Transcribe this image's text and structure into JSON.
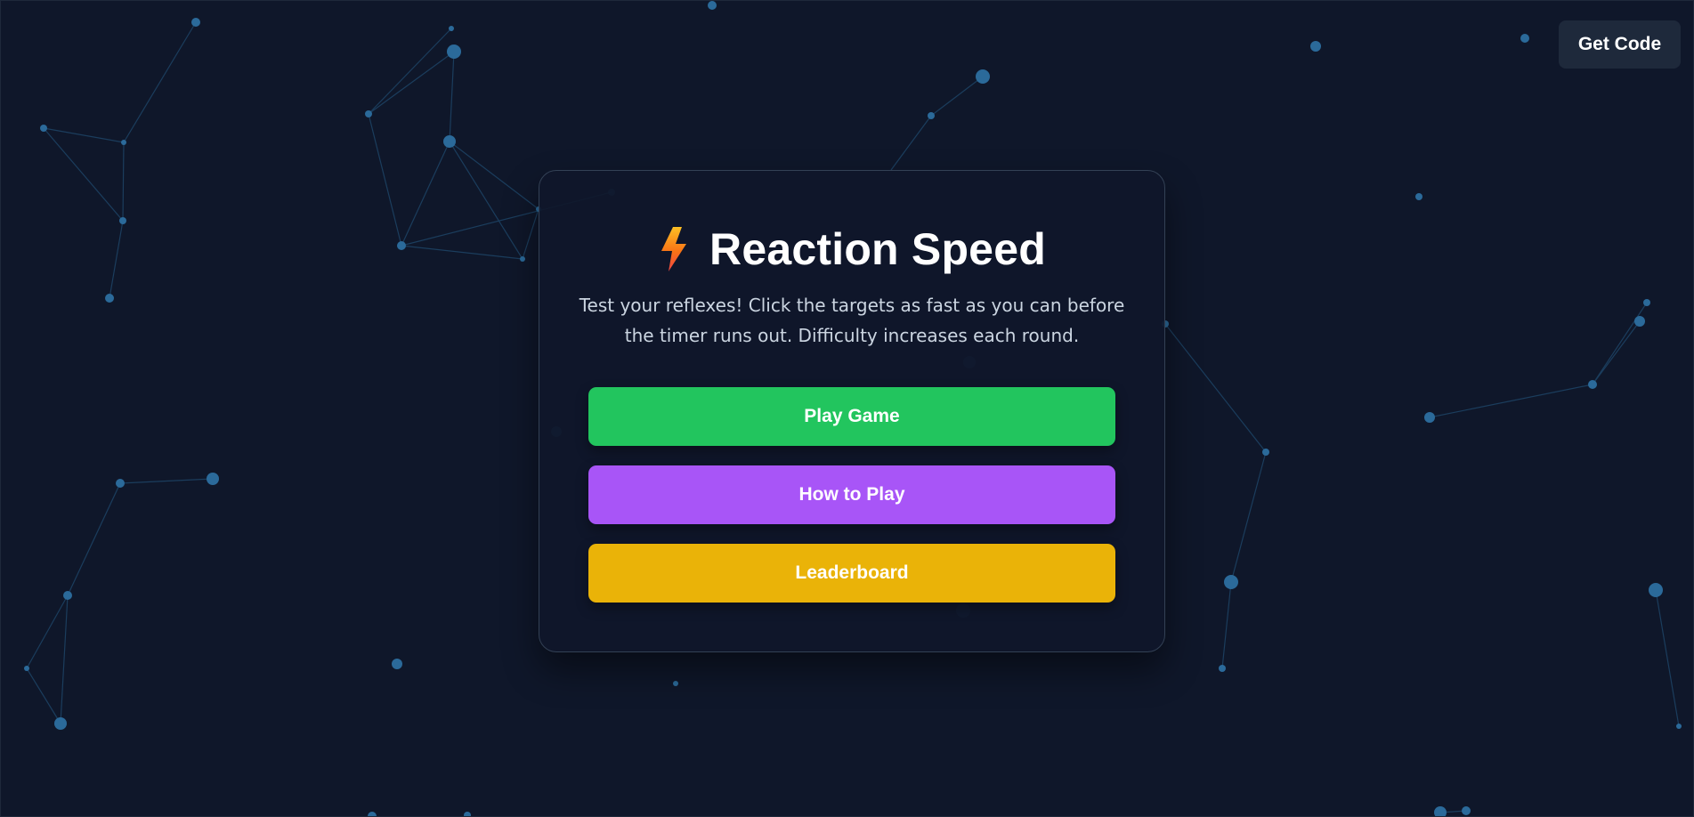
{
  "header": {
    "get_code_label": "Get Code"
  },
  "menu": {
    "icon": "lightning-bolt-icon",
    "title": "Reaction Speed",
    "description": "Test your reflexes! Click the targets as fast as you can before the timer runs out. Difficulty increases each round.",
    "buttons": [
      {
        "label": "Play Game",
        "color": "#22c55e"
      },
      {
        "label": "How to Play",
        "color": "#a855f7"
      },
      {
        "label": "Leaderboard",
        "color": "#eab308"
      }
    ]
  },
  "theme": {
    "background": "#0f172a",
    "node_color": "#2b6a9a",
    "bolt_gradient": [
      "#fbbf24",
      "#f97316",
      "#ef4444"
    ]
  }
}
